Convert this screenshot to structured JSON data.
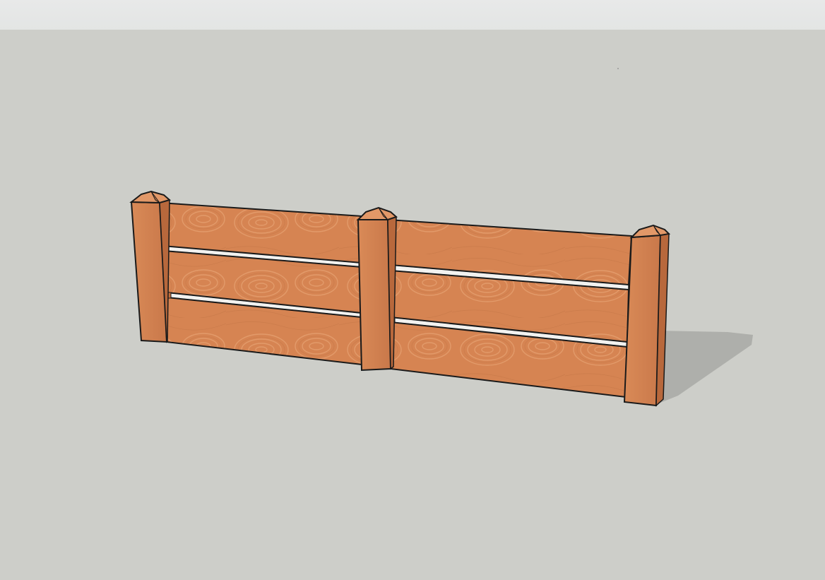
{
  "toolbar": {},
  "viewport": {
    "background_color": "#cdcec9",
    "model": {
      "object": "fence",
      "post_count": 3,
      "panel_count": 2,
      "rails_per_panel": 3,
      "material": "wood",
      "wood_color": "#d68452",
      "edge_color": "#1a1a1a",
      "shadow_color": "#aeafab"
    }
  }
}
